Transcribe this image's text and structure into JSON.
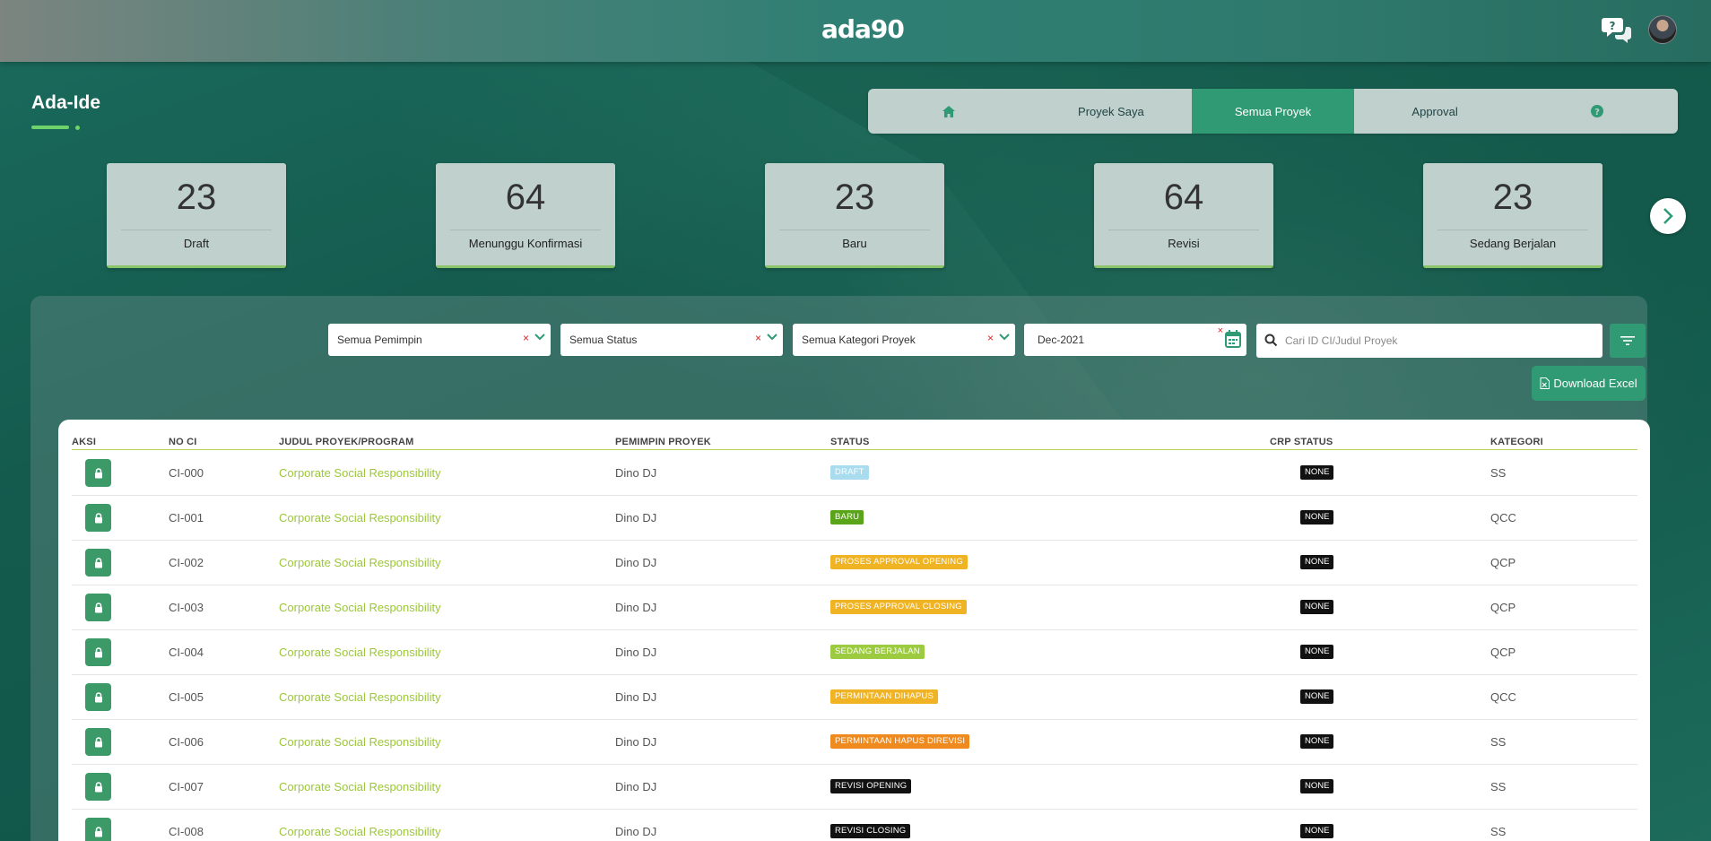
{
  "header": {
    "logo_text": "ada90",
    "help_icon": "help-chat-icon",
    "avatar_icon": "user-avatar"
  },
  "page": {
    "title": "Ada-Ide"
  },
  "tabs": [
    {
      "label": "",
      "icon": "home-icon",
      "active": false
    },
    {
      "label": "Proyek Saya",
      "active": false
    },
    {
      "label": "Semua Proyek",
      "active": true
    },
    {
      "label": "Approval",
      "active": false
    },
    {
      "label": "",
      "icon": "question-circle-icon",
      "active": false
    }
  ],
  "stats": [
    {
      "value": "23",
      "label": "Draft"
    },
    {
      "value": "64",
      "label": "Menunggu Konfirmasi"
    },
    {
      "value": "23",
      "label": "Baru"
    },
    {
      "value": "64",
      "label": "Revisi"
    },
    {
      "value": "23",
      "label": "Sedang Berjalan"
    }
  ],
  "filters": {
    "pemimpin": "Semua Pemimpin",
    "status": "Semua Status",
    "kategori": "Semua Kategori Proyek",
    "date": "Dec-2021",
    "clear": "×",
    "search_placeholder": "Cari ID CI/Judul Proyek"
  },
  "download_label": "Download Excel",
  "table": {
    "columns": [
      "AKSI",
      "NO CI",
      "JUDUL PROYEK/PROGRAM",
      "PEMIMPIN PROYEK",
      "STATUS",
      "CRP STATUS",
      "KATEGORI"
    ],
    "rows": [
      {
        "no": "CI-000",
        "title": "Corporate Social Responsibility",
        "leader": "Dino DJ",
        "status": "DRAFT",
        "crp": "NONE",
        "kategori": "SS"
      },
      {
        "no": "CI-001",
        "title": "Corporate Social Responsibility",
        "leader": "Dino DJ",
        "status": "BARU",
        "crp": "NONE",
        "kategori": "QCC"
      },
      {
        "no": "CI-002",
        "title": "Corporate Social Responsibility",
        "leader": "Dino DJ",
        "status": "PROSES APPROVAL OPENING",
        "crp": "NONE",
        "kategori": "QCP"
      },
      {
        "no": "CI-003",
        "title": "Corporate Social Responsibility",
        "leader": "Dino DJ",
        "status": "PROSES APPROVAL CLOSING",
        "crp": "NONE",
        "kategori": "QCP"
      },
      {
        "no": "CI-004",
        "title": "Corporate Social Responsibility",
        "leader": "Dino DJ",
        "status": "SEDANG BERJALAN",
        "crp": "NONE",
        "kategori": "QCP"
      },
      {
        "no": "CI-005",
        "title": "Corporate Social Responsibility",
        "leader": "Dino DJ",
        "status": "PERMINTAAN DIHAPUS",
        "crp": "NONE",
        "kategori": "QCC"
      },
      {
        "no": "CI-006",
        "title": "Corporate Social Responsibility",
        "leader": "Dino DJ",
        "status": "PERMINTAAN HAPUS DIREVISI",
        "crp": "NONE",
        "kategori": "SS"
      },
      {
        "no": "CI-007",
        "title": "Corporate Social Responsibility",
        "leader": "Dino DJ",
        "status": "REVISI OPENING",
        "crp": "NONE",
        "kategori": "SS"
      },
      {
        "no": "CI-008",
        "title": "Corporate Social Responsibility",
        "leader": "Dino DJ",
        "status": "REVISI CLOSING",
        "crp": "NONE",
        "kategori": "SS"
      }
    ]
  },
  "status_colors": {
    "DRAFT": "#a9dcef",
    "BARU": "#5aa419",
    "PROSES APPROVAL OPENING": "#f0b323",
    "PROSES APPROVAL CLOSING": "#f0b323",
    "SEDANG BERJALAN": "#9ccb3f",
    "PERMINTAAN DIHAPUS": "#f0b323",
    "PERMINTAAN HAPUS DIREVISI": "#ee8a1e",
    "REVISI OPENING": "#111111",
    "REVISI CLOSING": "#111111"
  }
}
